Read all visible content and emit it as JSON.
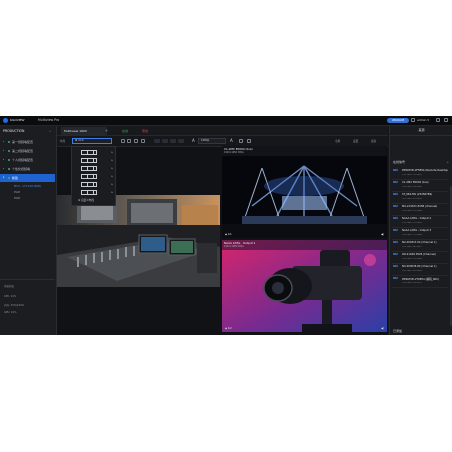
{
  "topbar": {
    "brand": "KILOVIEW",
    "app_name": "Multiview Pro",
    "upgrade_label": "UPGRADE",
    "user": "admin ▾"
  },
  "sidebar": {
    "header": "PRODUCTION",
    "collapse_glyph": "«",
    "items": [
      {
        "label": "第一视频墙配置"
      },
      {
        "label": "第二视频墙配置"
      },
      {
        "label": "个人视频墙配置"
      },
      {
        "label": "个性化视频墙"
      },
      {
        "label": "新建"
      }
    ],
    "sub_items": [
      "MV4 - 1774 00:00(B)",
      "PGM",
      "PGM"
    ],
    "stats_header": "系统状态",
    "stats": [
      "CPU: 11%",
      "内存: 32%/100%",
      "GPU: 41%"
    ]
  },
  "tabs": {
    "active": "Multiview 1600",
    "add": "+",
    "green": "在线",
    "red": "离线"
  },
  "toolbar": {
    "layout_label": "布局",
    "layout_value": "⊞ 4×4",
    "font_glyph": "A",
    "resolution": "1080p",
    "right_labels": [
      "全屏",
      "设置",
      "更多"
    ]
  },
  "dropdown": {
    "more_label": "⚙ 自定义布局"
  },
  "previews": [
    {
      "title": "",
      "sub": "",
      "corner": "",
      "vol": ""
    },
    {
      "title": "C1-2MX E0004 (live)",
      "sub": "1920×1080 30fps",
      "corner": "◉ 1/1",
      "vol": "◀)"
    },
    {
      "title": "NAAA k/Mix · Output 1",
      "sub": "1920×1080 60fps",
      "corner": "◉ 1/2",
      "vol": "◀)"
    }
  ],
  "rightpanel": {
    "header": "来源",
    "section_online": "在线信号",
    "section_add": "+",
    "section_bottom": "已添加",
    "sources": [
      {
        "badge": "NDI",
        "name": "DESKTOP-2F5E04 (Remote Desktop)",
        "ip": "192.168.1.23:5961"
      },
      {
        "badge": "NDI",
        "name": "C1-2MX E0004 (live)",
        "ip": "192.168.1.45:5962"
      },
      {
        "badge": "NDI",
        "name": "ST_NDI-MS (23456789)",
        "ip": "192.168.1.52:5963"
      },
      {
        "badge": "NDI",
        "name": "MX-214321 8258 (channel)",
        "ip": "192.168.1.61:5964"
      },
      {
        "badge": "NDI",
        "name": "NAAA k/Mix - Output 2",
        "ip": "192.168.1.70:5965"
      },
      {
        "badge": "NDI",
        "name": "NAAA k/Mix - Output 3",
        "ip": "192.168.1.71:5966"
      },
      {
        "badge": "NDI",
        "name": "N2-200313 02 (Channel 1)",
        "ip": "192.168.1.80:5967"
      },
      {
        "badge": "NDI",
        "name": "DR-21949 0526 (Channel)",
        "ip": "192.168.1.81:5968"
      },
      {
        "badge": "NDI",
        "name": "N3-293036 82 (Channel 1)",
        "ip": "192.168.1.82:5969"
      },
      {
        "badge": "NDI",
        "name": "DESKTOP-2T0E04 (编辑_NDI)",
        "ip": "192.168.1.90:5970"
      }
    ]
  },
  "colors": {
    "accent": "#1f63d1",
    "online": "#35b26b",
    "offline": "#e0484e",
    "background": "#141619"
  }
}
